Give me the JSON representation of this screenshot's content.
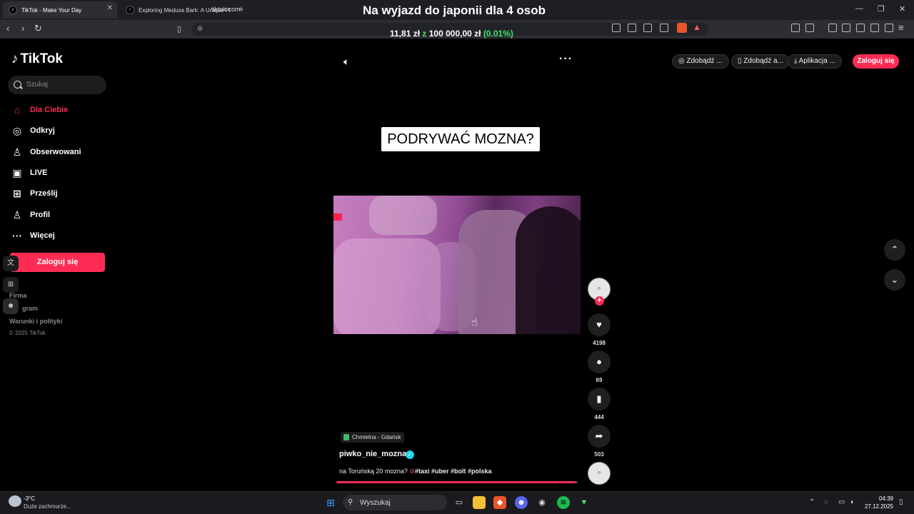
{
  "browser": {
    "tabs": [
      {
        "label": "TikTok - Make Your Day",
        "active": true
      },
      {
        "label": "Exploring Medusa Bark: A Unique Pla",
        "active": false
      }
    ],
    "url": "tiktok.com",
    "overlay_title": "Na wyjazd do japonii dla 4 osob",
    "donation": {
      "raised": "11,81 zł",
      "z": "z",
      "goal": "100 000,00 zł",
      "percent": "(0.01%)"
    }
  },
  "sidebar": {
    "logo": "TikTok",
    "search_placeholder": "Szukaj",
    "items": [
      {
        "label": "Dla Ciebie",
        "icon": "home-icon"
      },
      {
        "label": "Odkryj",
        "icon": "compass-icon"
      },
      {
        "label": "Obserwowani",
        "icon": "following-icon"
      },
      {
        "label": "LIVE",
        "icon": "live-icon"
      },
      {
        "label": "Prześlij",
        "icon": "upload-icon"
      },
      {
        "label": "Profil",
        "icon": "profile-icon"
      },
      {
        "label": "Więcej",
        "icon": "more-icon"
      }
    ],
    "login_label": "Zaloguj się",
    "footer": {
      "firma": "Firma",
      "program": "gram",
      "terms": "Warunki i polityki",
      "copyright": "© 2025 TikTok"
    }
  },
  "header": {
    "pills": [
      "Zdobądź ...",
      "Zdobądź a...",
      "Aplikacja ..."
    ],
    "login_label": "Zaloguj się"
  },
  "video": {
    "caption": "PODRYWAĆ MOZNA?",
    "location": "Chmielna - Gdańsk",
    "username": "piwko_nie_mozna",
    "description_text": "na Toruńską 20 mozna? ",
    "description_tags": "#taxi #uber #bolt #polska",
    "progress": 0.99,
    "avatar_text": "PIWKO NIE MOZNA"
  },
  "actions": {
    "likes": "4198",
    "comments": "69",
    "saves": "444",
    "shares": "503"
  },
  "taskbar": {
    "weather_temp": "-3°C",
    "weather_desc": "Duże zachmurze...",
    "search_label": "Wyszukaj",
    "time": "04:39",
    "date": "27.12.2025"
  },
  "colors": {
    "accent": "#fe2c55",
    "verified": "#20d5ec",
    "donation_green": "#3fe36b"
  }
}
